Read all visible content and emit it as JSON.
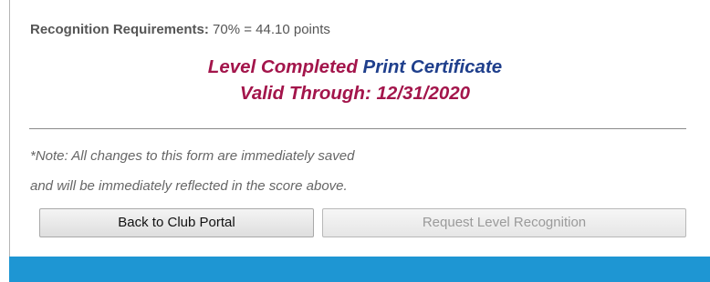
{
  "requirements": {
    "label": "Recognition Requirements:",
    "value": " 70% = 44.10 points"
  },
  "status": {
    "level_text": "Level Completed",
    "print_link": " Print Certificate",
    "valid_through": "Valid Through: 12/31/2020"
  },
  "note": {
    "line1": "*Note: All changes to this form are immediately saved",
    "line2": "and will be immediately reflected in the score above."
  },
  "buttons": {
    "back_label": "Back to Club Portal",
    "request_label": "Request Level Recognition"
  },
  "colors": {
    "status_red": "#a3154b",
    "link_blue": "#1f3f8c",
    "footer_blue": "#1e96d3"
  }
}
